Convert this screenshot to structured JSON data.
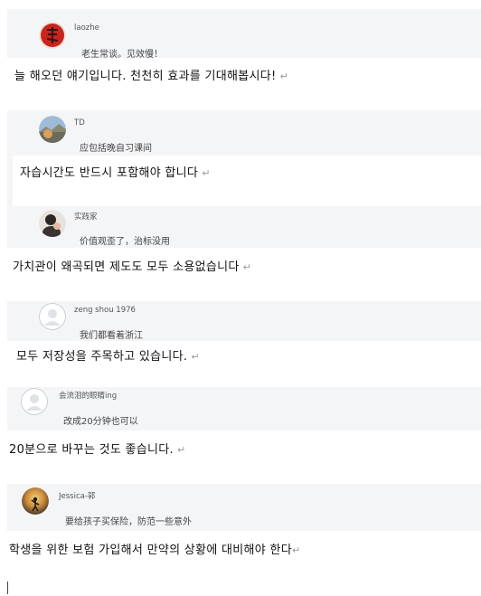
{
  "paragraph_mark": "↵",
  "comments": [
    {
      "username": "laozhe",
      "comment": "老生常谈。见效慢！",
      "translation": "늘 해오던 얘기입니다. 천천히 효과를 기대해봅시다!",
      "avatar_icon": "red-calligraphy-avatar-icon"
    },
    {
      "username": "TD",
      "comment": "应包括晚自习课间",
      "translation": "자습시간도 반드시 포함해야 합니다",
      "avatar_icon": "landscape-photo-avatar-icon"
    },
    {
      "username": "实践家",
      "comment": "价值观歪了，治标没用",
      "translation": "가치관이 왜곡되면 제도도 모두 소용없습니다",
      "avatar_icon": "person-photo-avatar-icon"
    },
    {
      "username": "zeng shou 1976",
      "comment": "我们都看着浙江",
      "translation": "모두 저장성을 주목하고 있습니다.",
      "avatar_icon": "default-user-avatar-icon"
    },
    {
      "username": "会流泪的眼睛ing",
      "comment": "改成20分钟也可以",
      "translation": "20분으로 바꾸는 것도 좋습니다.",
      "avatar_icon": "default-user-avatar-icon"
    },
    {
      "username": "Jessica-郭",
      "comment": "要给孩子买保险，防范一些意外",
      "translation": "학생을 위한 보험 가입해서 만약의 상황에 대비해야 한다",
      "avatar_icon": "sunset-silhouette-avatar-icon"
    }
  ]
}
